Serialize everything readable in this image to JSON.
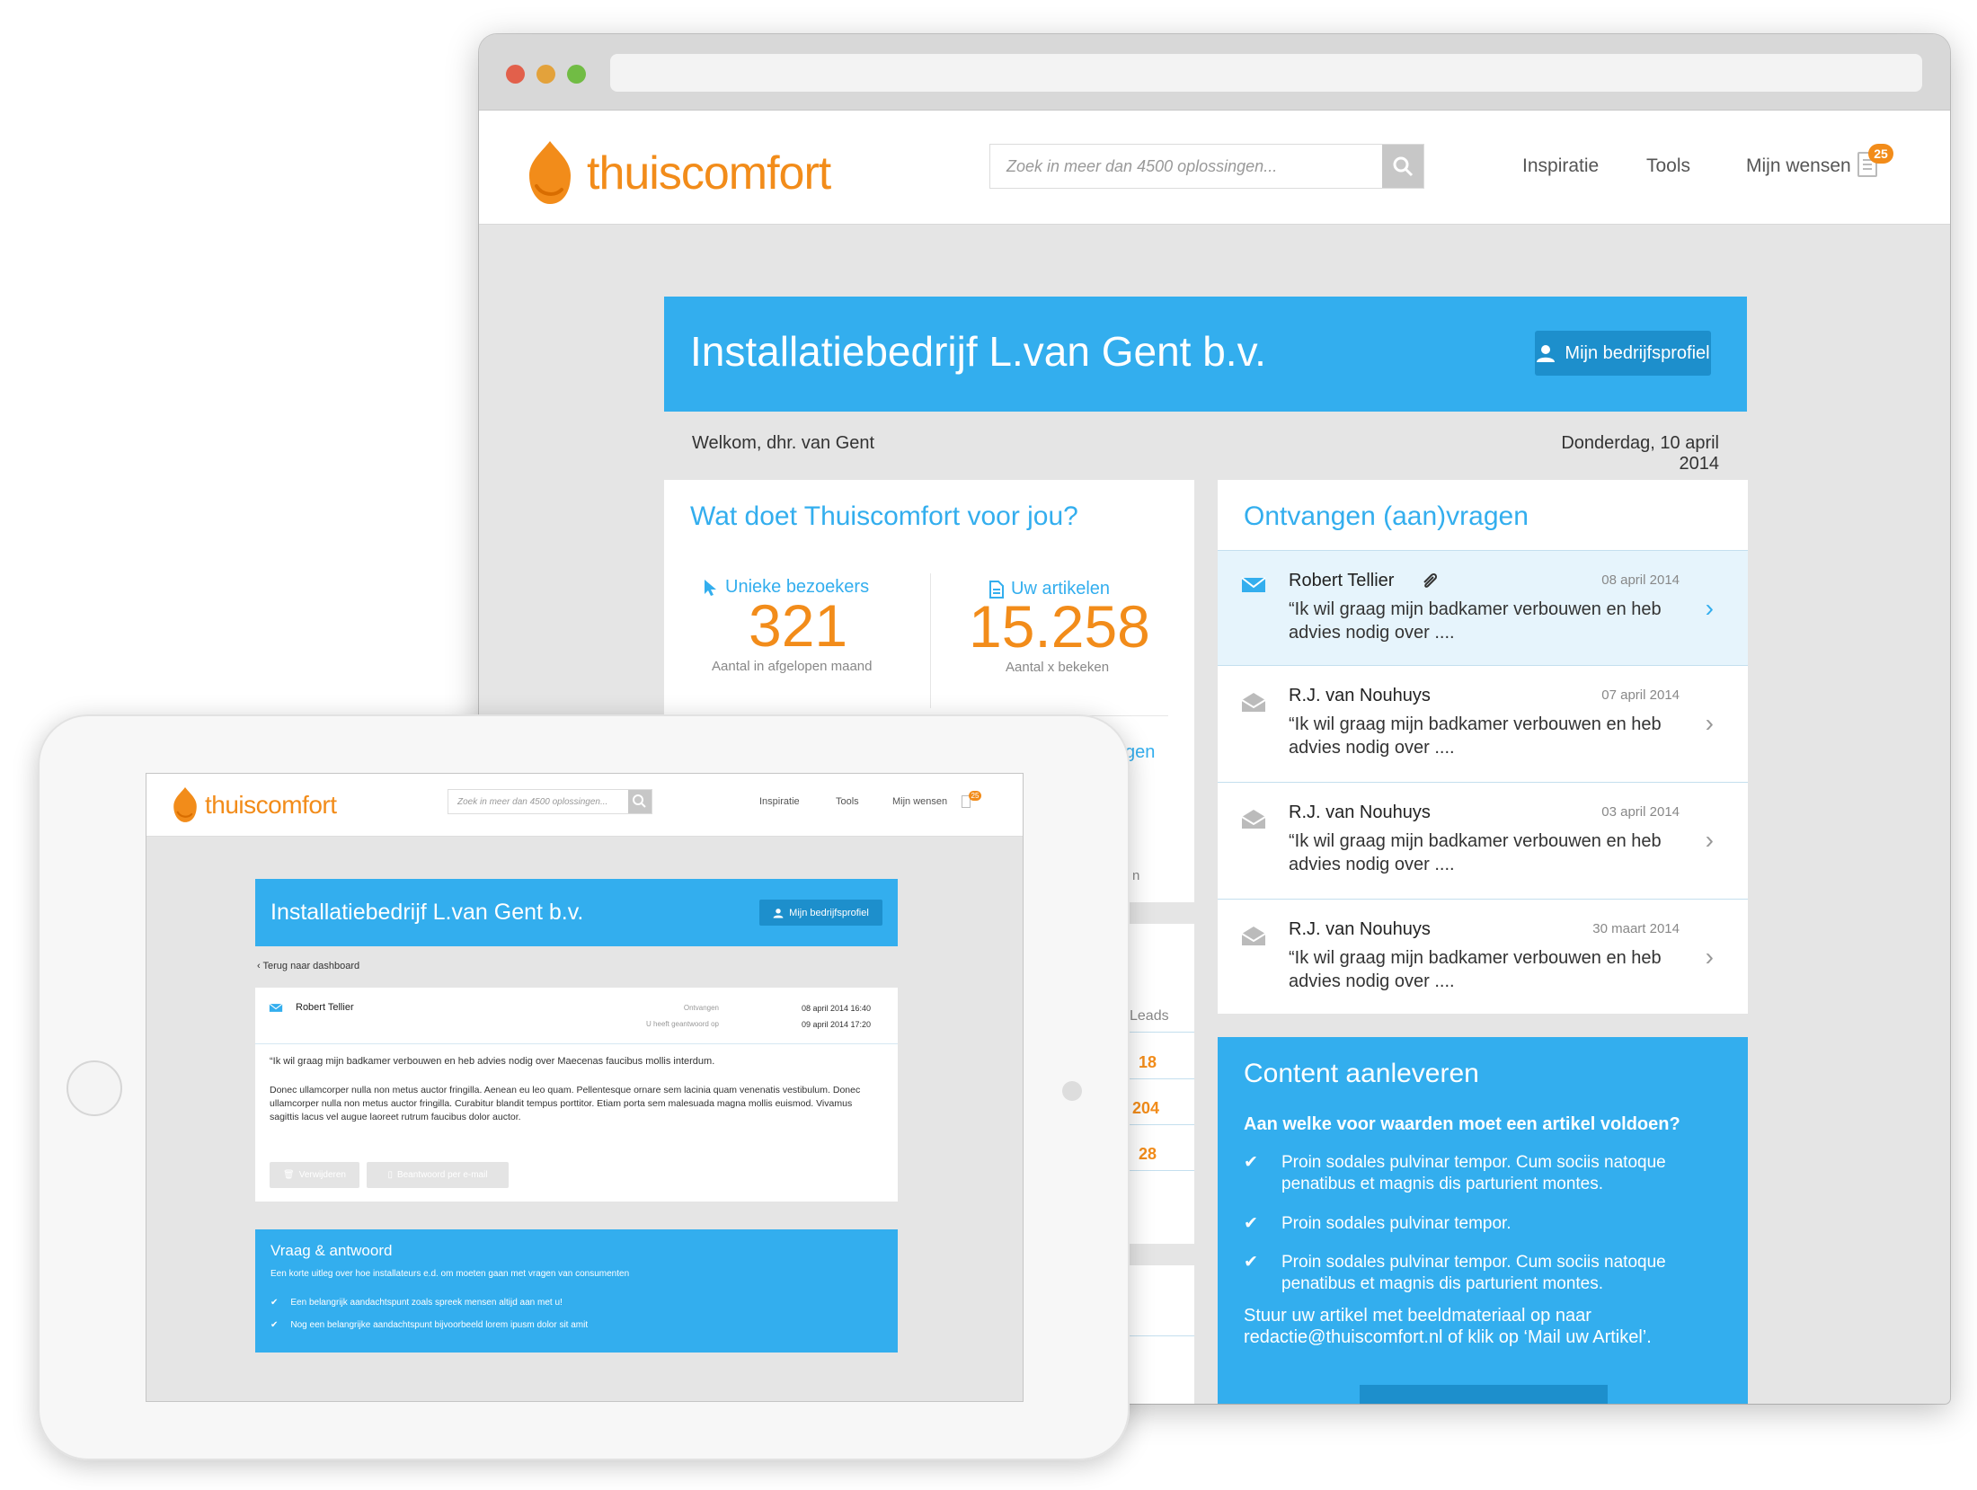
{
  "desktop": {
    "brand": "thuiscomfort",
    "search": {
      "placeholder": "Zoek in meer dan 4500 oplossingen..."
    },
    "nav": [
      "Inspiratie",
      "Tools",
      "Mijn wensen"
    ],
    "wish_count": "25",
    "hero": {
      "title": "Installatiebedrijf L.van Gent b.v.",
      "profile_button": "Mijn bedrijfsprofiel"
    },
    "welcome": "Welkom, dhr. van Gent",
    "date": "Donderdag, 10 april 2014",
    "stats": {
      "title": "Wat doet Thuiscomfort voor jou?",
      "visitors": {
        "label": "Unieke bezoekers",
        "value": "321",
        "sub": "Aantal in afgelopen maand"
      },
      "articles": {
        "label": "Uw artikelen",
        "value": "15.258",
        "sub": "Aantal x bekeken"
      },
      "partial_link": "gen",
      "partial_text": "n"
    },
    "leads": {
      "header": "Leads",
      "values": [
        "18",
        "204",
        "28"
      ]
    },
    "inbox": {
      "title": "Ontvangen (aan)vragen",
      "messages": [
        {
          "from": "Robert Tellier",
          "date": "08 april 2014",
          "text": "“Ik wil graag mijn badkamer verbouwen en heb advies nodig over ...."
        },
        {
          "from": "R.J. van Nouhuys",
          "date": "07 april 2014",
          "text": "“Ik wil graag mijn badkamer verbouwen en heb advies nodig over ...."
        },
        {
          "from": "R.J. van Nouhuys",
          "date": "03 april 2014",
          "text": "“Ik wil graag mijn badkamer verbouwen en heb advies nodig over ...."
        },
        {
          "from": "R.J. van Nouhuys",
          "date": "30 maart 2014",
          "text": "“Ik wil graag mijn badkamer verbouwen en heb advies nodig over ...."
        }
      ]
    },
    "content": {
      "title": "Content aanleveren",
      "question": "Aan welke voor waarden moet een artikel voldoen?",
      "items": [
        "Proin sodales pulvinar tempor. Cum sociis natoque penatibus et magnis dis parturient montes.",
        "Proin sodales pulvinar tempor.",
        "Proin sodales pulvinar tempor. Cum sociis natoque penatibus et magnis dis parturient montes."
      ],
      "footer": "Stuur uw artikel met beeldmateriaal op naar redactie@thuiscomfort.nl of klik op ‘Mail uw Artikel’."
    }
  },
  "tablet": {
    "brand": "thuiscomfort",
    "search": {
      "placeholder": "Zoek in meer dan 4500 oplossingen..."
    },
    "nav": [
      "Inspiratie",
      "Tools",
      "Mijn wensen"
    ],
    "wish_count": "25",
    "hero": {
      "title": "Installatiebedrijf L.van Gent b.v.",
      "profile_button": "Mijn bedrijfsprofiel"
    },
    "back": "Terug naar dashboard",
    "message": {
      "from": "Robert Tellier",
      "received_label": "Ontvangen",
      "received_value": "08 april 2014 16:40",
      "answered_label": "U heeft geantwoord op",
      "answered_value": "09 april 2014 17:20",
      "quote": "“Ik wil graag mijn badkamer verbouwen en heb advies nodig over Maecenas faucibus mollis interdum.",
      "body": "Donec ullamcorper nulla non metus auctor fringilla. Aenean eu leo quam. Pellentesque ornare sem lacinia quam venenatis vestibulum. Donec ullamcorper nulla non metus auctor fringilla. Curabitur blandit tempus porttitor. Etiam porta sem malesuada magna mollis euismod. Vivamus sagittis lacus vel augue laoreet rutrum faucibus dolor auctor.",
      "delete_button": "Verwijderen",
      "reply_button": "Beantwoord per e-mail"
    },
    "qa": {
      "title": "Vraag & antwoord",
      "subtitle": "Een korte uitleg over hoe installateurs e.d. om moeten gaan met  vragen van consumenten",
      "items": [
        "Een belangrijk aandachtspunt zoals spreek mensen altijd aan met u!",
        "Nog een belangrijke aandachtspunt bijvoorbeeld lorem ipusm dolor sit amit"
      ]
    }
  },
  "colors": {
    "accent": "#33aeee",
    "brand": "#f28c1a",
    "button_dark": "#1d8fcc"
  }
}
